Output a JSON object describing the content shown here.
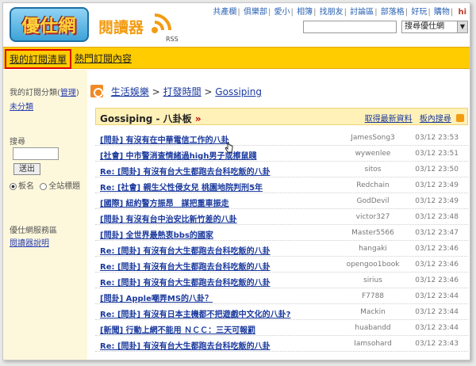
{
  "header": {
    "logo_text": "優仕網",
    "reader_title": "閱讀器",
    "rss_label": "RSS",
    "top_links": [
      "共產欄",
      "俱樂部",
      "愛小",
      "相簿",
      "找朋友",
      "討論區",
      "部落格",
      "好玩",
      "購物"
    ],
    "greeting": "hi",
    "search_select_value": "搜尋優仕網"
  },
  "nav": {
    "my_subscriptions": "我的訂閱清單",
    "hot_subscriptions": "熱門訂閱內容"
  },
  "sidebar": {
    "category_label": "我的訂閱分類",
    "manage_link": "管理",
    "uncategorized": "未分類",
    "search_label": "搜尋",
    "submit": "送出",
    "radio_board": "板名",
    "radio_all": "全站標題",
    "service_label": "優仕網服務區",
    "reader_help": "閱讀器說明"
  },
  "breadcrumb": {
    "level1": "生活娛樂",
    "sep": ">",
    "level2": "打發時間",
    "level3": "Gossiping"
  },
  "board": {
    "title": "Gossiping - 八卦板",
    "arrow": "»",
    "latest_link": "取得最新資料",
    "search_link": "板內搜尋"
  },
  "posts": [
    {
      "title": "[問卦] 有沒有在中華電信工作的八卦",
      "author": "JamesSong3",
      "time": "03/12 23:53"
    },
    {
      "title": "[社會] 中市警消查情緒過high男子或擦鼠踐",
      "author": "wywenlee",
      "time": "03/12 23:51"
    },
    {
      "title": "Re: [問卦] 有沒有台大生都跑去台科吃飯的八卦",
      "author": "sitos",
      "time": "03/12 23:50"
    },
    {
      "title": "Re: [社會] 親生父性侵女兒 桃園地院判刑5年",
      "author": "Redchain",
      "time": "03/12 23:49"
    },
    {
      "title": "[國際] 紐約警方振昂　謀把重車振走",
      "author": "GodDevil",
      "time": "03/12 23:49"
    },
    {
      "title": "[問卦] 有沒有台中治安比新竹差的八卦",
      "author": "victor327",
      "time": "03/12 23:48"
    },
    {
      "title": "[問卦] 全世界最熱衷bbs的國家",
      "author": "Master5566",
      "time": "03/12 23:47"
    },
    {
      "title": "Re: [問卦] 有沒有台大生都跑去台科吃飯的八卦",
      "author": "hangaki",
      "time": "03/12 23:46"
    },
    {
      "title": "Re: [問卦] 有沒有台大生都跑去台科吃飯的八卦",
      "author": "opengoo1book",
      "time": "03/12 23:46"
    },
    {
      "title": "Re: [問卦] 有沒有台大生都跑去台科吃飯的八卦",
      "author": "sirius",
      "time": "03/12 23:46"
    },
    {
      "title": "[問卦] Apple嘲弄MS的八卦？",
      "author": "F7788",
      "time": "03/12 23:44"
    },
    {
      "title": "Re: [問卦] 有沒有日本主機都不把遊戲中文化的八卦?",
      "author": "Mackin",
      "time": "03/12 23:44"
    },
    {
      "title": "[新聞] 行動上網不能用 ＮＣＣ：三天可報罰",
      "author": "huabandd",
      "time": "03/12 23:44"
    },
    {
      "title": "Re: [問卦] 有沒有台大生都跑去台科吃飯的八卦",
      "author": "Iamsohard",
      "time": "03/12 23:43"
    }
  ],
  "colors": {
    "nav_bg": "#ffcc00",
    "sidebar_bg": "#fdf8dc",
    "link": "#1b3a9e",
    "highlight_border": "#e00000"
  }
}
